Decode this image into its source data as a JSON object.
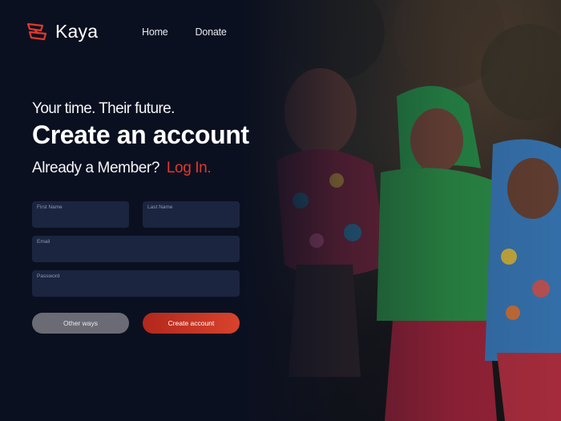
{
  "brand": {
    "name": "Kaya",
    "icon": "kaya-logo-icon",
    "accent": "#e0392b"
  },
  "nav": {
    "items": [
      {
        "label": "Home"
      },
      {
        "label": "Donate"
      }
    ]
  },
  "hero": {
    "tagline": "Your time. Their future.",
    "headline": "Create an account",
    "member_prompt": "Already a Member?",
    "login_link": "Log In."
  },
  "form": {
    "first_name": {
      "label": "First Name",
      "value": ""
    },
    "last_name": {
      "label": "Last Name",
      "value": ""
    },
    "email": {
      "label": "Email",
      "value": ""
    },
    "password": {
      "label": "Password",
      "value": ""
    }
  },
  "buttons": {
    "other": "Other ways",
    "create": "Create account"
  },
  "colors": {
    "background": "#0b1020",
    "field": "#1b2540",
    "secondary_button": "#6a6b74",
    "primary_button": "#d8432c"
  }
}
